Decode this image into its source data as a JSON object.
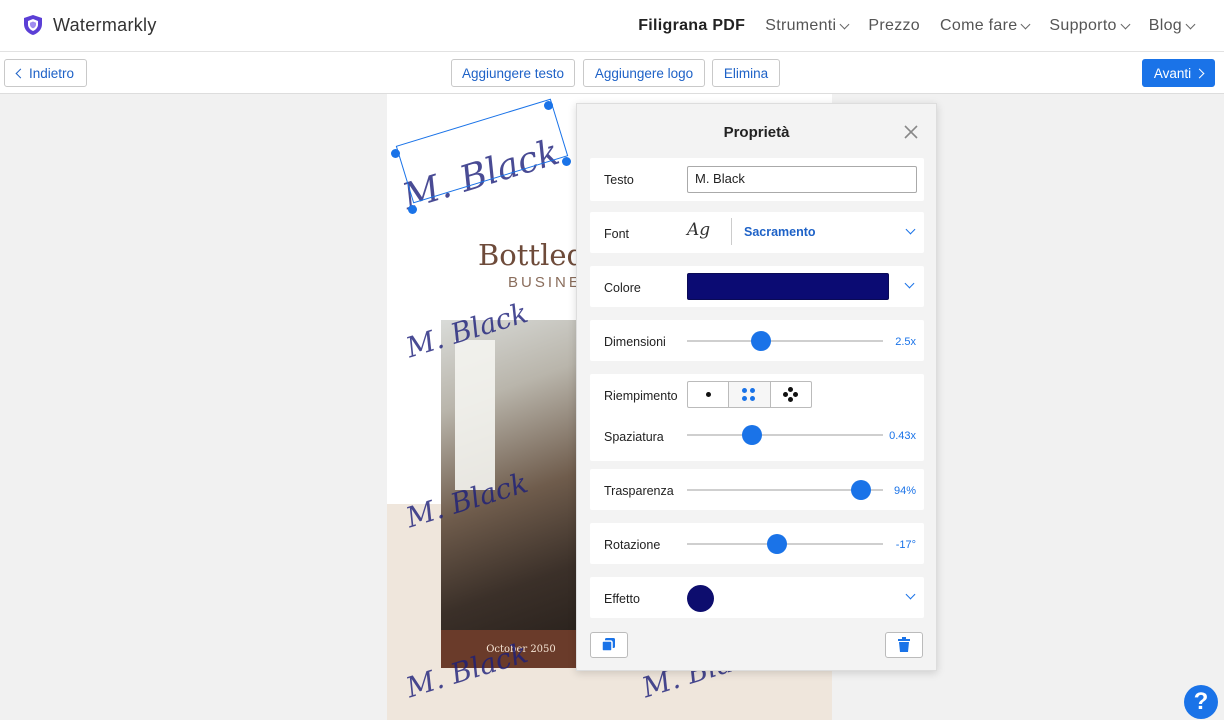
{
  "brand": {
    "name": "Watermarkly",
    "accent": "#5b3fd6"
  },
  "nav": {
    "items": [
      {
        "label": "Filigrana PDF"
      },
      {
        "label": "Strumenti"
      },
      {
        "label": "Prezzo"
      },
      {
        "label": "Come fare"
      },
      {
        "label": "Supporto"
      },
      {
        "label": "Blog"
      }
    ]
  },
  "toolbar": {
    "back_label": "Indietro",
    "add_text_label": "Aggiungere testo",
    "add_logo_label": "Aggiungere logo",
    "delete_label": "Elimina",
    "next_label": "Avanti"
  },
  "document": {
    "title": "Bottled",
    "subtitle": "BUSINE",
    "caption": "October 2050",
    "watermark_text": "M. Black"
  },
  "panel": {
    "title": "Proprietà",
    "text": {
      "label": "Testo",
      "value": "M. Black"
    },
    "font": {
      "label": "Font",
      "sample": "Ag",
      "name": "Sacramento"
    },
    "color": {
      "label": "Colore",
      "value": "#0b0b73"
    },
    "size": {
      "label": "Dimensioni",
      "value_text": "2.5x",
      "fraction": 0.38
    },
    "fill": {
      "label": "Riempimento",
      "selected_index": 1
    },
    "spacing": {
      "label": "Spaziatura",
      "value_text": "0.43x",
      "fraction": 0.33
    },
    "transparency": {
      "label": "Trasparenza",
      "value_text": "94%",
      "fraction": 0.89
    },
    "rotation": {
      "label": "Rotazione",
      "value_text": "-17°",
      "fraction": 0.46
    },
    "effect": {
      "label": "Effetto",
      "color": "#0d0d6e"
    }
  },
  "help": {
    "label": "?"
  }
}
